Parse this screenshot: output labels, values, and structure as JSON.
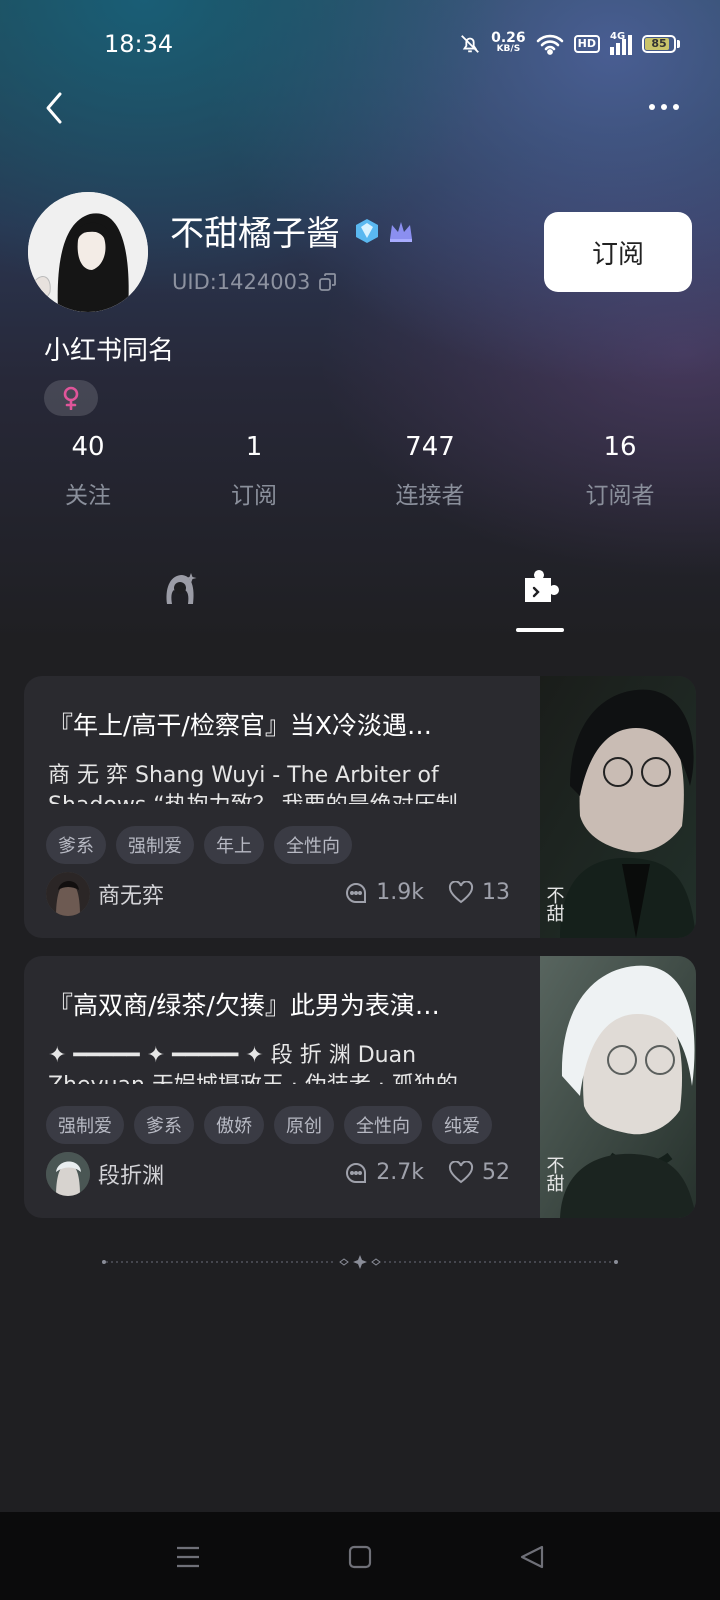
{
  "status_bar": {
    "time": "18:34",
    "net_speed_value": "0.26",
    "net_speed_unit": "KB/S",
    "hd": "HD",
    "network": "4G",
    "battery": "85"
  },
  "profile": {
    "name": "不甜橘子酱",
    "uid": "UID:1424003",
    "bio": "小红书同名",
    "subscribe_label": "订阅",
    "gender_icon": "female-icon"
  },
  "stats": [
    {
      "value": "40",
      "label": "关注"
    },
    {
      "value": "1",
      "label": "订阅"
    },
    {
      "value": "747",
      "label": "连接者"
    },
    {
      "value": "16",
      "label": "订阅者"
    }
  ],
  "tabs": [
    {
      "icon": "character-icon",
      "active": false
    },
    {
      "icon": "puzzle-icon",
      "active": true
    }
  ],
  "cards": [
    {
      "title": "『年上/高干/检察官』当X冷淡遇…",
      "desc_line1": "商 无 弈 Shang Wuyi - The Arbiter of",
      "desc_line2": "Shadows “热抱力致？ 我要的是绝对压制",
      "tags": [
        "爹系",
        "强制爱",
        "年上",
        "全性向"
      ],
      "author": "商无弈",
      "comments": "1.9k",
      "likes": "13"
    },
    {
      "title": "『高双商/绿茶/欠揍』此男为表演…",
      "desc_line1": "✦ ━━━━━ ✦ ━━━━━ ✦ 段 折 渊 Duan",
      "desc_line2": "Zheyuan 天娱城摄政王 · 伪装者 · 孤独的",
      "tags": [
        "强制爱",
        "爹系",
        "傲娇",
        "原创",
        "全性向",
        "纯爱"
      ],
      "author": "段折渊",
      "comments": "2.7k",
      "likes": "52"
    }
  ],
  "colors": {
    "accent_pink": "#e0559a",
    "card_bg": "#2a2a2f",
    "page_bg": "#1f1f22"
  }
}
